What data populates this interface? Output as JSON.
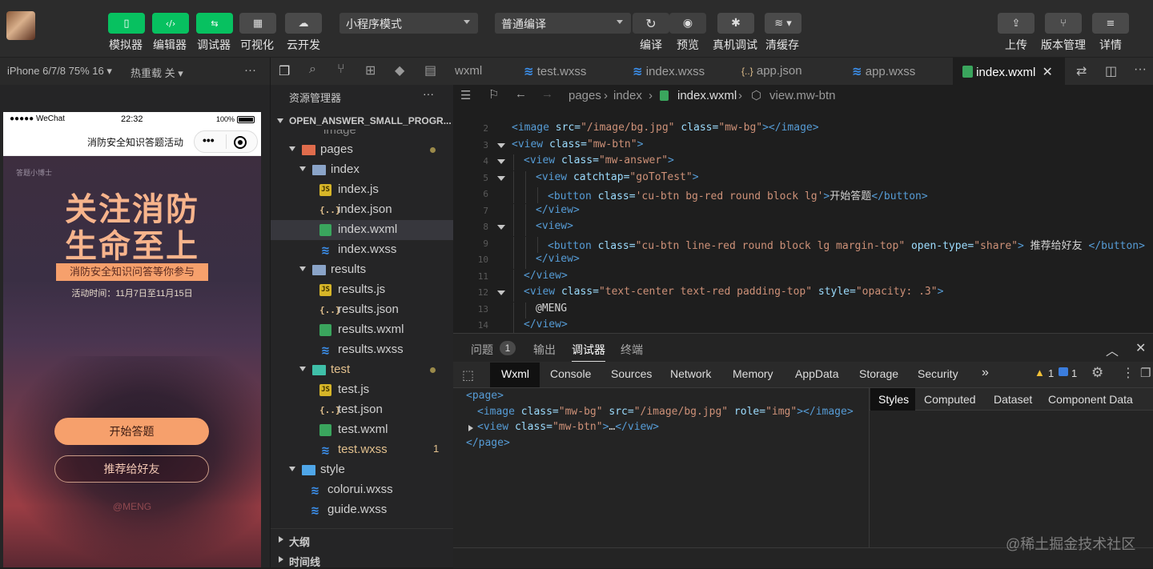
{
  "toolbar": {
    "buttons": [
      {
        "label": "模拟器",
        "icon": "phone-icon"
      },
      {
        "label": "编辑器",
        "icon": "code-icon"
      },
      {
        "label": "调试器",
        "icon": "debug-icon"
      },
      {
        "label": "可视化",
        "icon": "layout-icon"
      },
      {
        "label": "云开发",
        "icon": "cloud-icon"
      }
    ],
    "mode_select": "小程序模式",
    "compile_select": "普通编译",
    "actions": [
      {
        "label": "编译",
        "icon": "refresh-icon"
      },
      {
        "label": "预览",
        "icon": "eye-icon"
      },
      {
        "label": "真机调试",
        "icon": "bug-icon"
      },
      {
        "label": "清缓存",
        "icon": "layers-icon"
      }
    ],
    "right_actions": [
      {
        "label": "上传",
        "icon": "upload-icon"
      },
      {
        "label": "版本管理",
        "icon": "branch-icon"
      },
      {
        "label": "详情",
        "icon": "menu-icon"
      }
    ]
  },
  "simulator": {
    "device": "iPhone 6/7/8 75% 16 ▾",
    "hot_reload": "热重载 关 ▾",
    "more": "···",
    "status_carrier": "●●●●● WeChat",
    "status_time": "22:32",
    "status_battery": "100%",
    "nav_title": "消防安全知识答题活动",
    "brand": "答题小博士",
    "poster_title_1": "关注消防",
    "poster_title_2": "生命至上",
    "poster_banner": "消防安全知识问答等你参与",
    "poster_date": "活动时间：11月7日至11月15日",
    "start_button": "开始答题",
    "share_button": "推荐给好友",
    "footer": "@MENG"
  },
  "explorer": {
    "title": "资源管理器",
    "more": "···",
    "project": "OPEN_ANSWER_SMALL_PROGR...",
    "partial_row": "image",
    "rows": [
      {
        "label": "pages",
        "type": "folder-pages",
        "depth": 1,
        "open": true,
        "dot": true
      },
      {
        "label": "index",
        "type": "folder",
        "depth": 2,
        "open": true
      },
      {
        "label": "index.js",
        "type": "js",
        "depth": 3
      },
      {
        "label": "index.json",
        "type": "json",
        "depth": 3
      },
      {
        "label": "index.wxml",
        "type": "wxml",
        "depth": 3,
        "selected": true
      },
      {
        "label": "index.wxss",
        "type": "wxss",
        "depth": 3
      },
      {
        "label": "results",
        "type": "folder",
        "depth": 2,
        "open": true
      },
      {
        "label": "results.js",
        "type": "js",
        "depth": 3
      },
      {
        "label": "results.json",
        "type": "json",
        "depth": 3
      },
      {
        "label": "results.wxml",
        "type": "wxml",
        "depth": 3
      },
      {
        "label": "results.wxss",
        "type": "wxss",
        "depth": 3
      },
      {
        "label": "test",
        "type": "folder-test",
        "depth": 2,
        "open": true,
        "dot": true,
        "modified": true
      },
      {
        "label": "test.js",
        "type": "js",
        "depth": 3
      },
      {
        "label": "test.json",
        "type": "json",
        "depth": 3
      },
      {
        "label": "test.wxml",
        "type": "wxml",
        "depth": 3
      },
      {
        "label": "test.wxss",
        "type": "wxss",
        "depth": 3,
        "modified": true,
        "count": "1"
      },
      {
        "label": "style",
        "type": "folder-style",
        "depth": 1,
        "open": true
      },
      {
        "label": "colorui.wxss",
        "type": "wxss",
        "depth": 2
      },
      {
        "label": "guide.wxss",
        "type": "wxss",
        "depth": 2
      }
    ],
    "outline": "大纲",
    "timeline": "时间线"
  },
  "editor_tabs": [
    {
      "label": "wxml",
      "icon": ""
    },
    {
      "label": "test.wxss",
      "icon": "wxss"
    },
    {
      "label": "index.wxss",
      "icon": "wxss"
    },
    {
      "label": "app.json",
      "icon": "json"
    },
    {
      "label": "app.wxss",
      "icon": "wxss"
    },
    {
      "label": "index.wxml",
      "icon": "wxml",
      "active": true
    }
  ],
  "breadcrumb": [
    "pages",
    "index",
    "index.wxml",
    "view.mw-btn"
  ],
  "code_lines": [
    {
      "n": "2",
      "indent": 0,
      "fold": false,
      "parts": [
        [
          "tg",
          "<image "
        ],
        [
          "at",
          "src="
        ],
        [
          "st",
          "\"/image/bg.jpg\""
        ],
        [
          "at",
          " class="
        ],
        [
          "st",
          "\"mw-bg\""
        ],
        [
          "tg",
          "></image>"
        ]
      ]
    },
    {
      "n": "3",
      "indent": 0,
      "fold": true,
      "parts": [
        [
          "tg",
          "<view "
        ],
        [
          "at",
          "class="
        ],
        [
          "st",
          "\"mw-btn\""
        ],
        [
          "tg",
          ">"
        ]
      ]
    },
    {
      "n": "4",
      "indent": 1,
      "fold": true,
      "parts": [
        [
          "tg",
          "<view "
        ],
        [
          "at",
          "class="
        ],
        [
          "st",
          "\"mw-answer\""
        ],
        [
          "tg",
          ">"
        ]
      ]
    },
    {
      "n": "5",
      "indent": 2,
      "fold": true,
      "parts": [
        [
          "tg",
          "<view "
        ],
        [
          "at",
          "catchtap="
        ],
        [
          "st",
          "\"goToTest\""
        ],
        [
          "tg",
          ">"
        ]
      ]
    },
    {
      "n": "6",
      "indent": 3,
      "fold": false,
      "parts": [
        [
          "tg",
          "<button "
        ],
        [
          "at",
          "class="
        ],
        [
          "st",
          "'cu-btn bg-red round block lg'"
        ],
        [
          "tg",
          ">"
        ],
        [
          "tx",
          "开始答题"
        ],
        [
          "tg",
          "</button>"
        ]
      ]
    },
    {
      "n": "7",
      "indent": 2,
      "fold": false,
      "parts": [
        [
          "tg",
          "</view>"
        ]
      ]
    },
    {
      "n": "8",
      "indent": 2,
      "fold": true,
      "parts": [
        [
          "tg",
          "<view>"
        ]
      ]
    },
    {
      "n": "9",
      "indent": 3,
      "fold": false,
      "parts": [
        [
          "tg",
          "<button "
        ],
        [
          "at",
          "class="
        ],
        [
          "st",
          "\"cu-btn line-red round block lg margin-top\""
        ],
        [
          "at",
          " open-type="
        ],
        [
          "st",
          "\"share\""
        ],
        [
          "tg",
          ">"
        ],
        [
          "tx",
          " 推荐给好友 "
        ],
        [
          "tg",
          "</button>"
        ]
      ]
    },
    {
      "n": "10",
      "indent": 2,
      "fold": false,
      "parts": [
        [
          "tg",
          "</view>"
        ]
      ]
    },
    {
      "n": "11",
      "indent": 1,
      "fold": false,
      "parts": [
        [
          "tg",
          "</view>"
        ]
      ]
    },
    {
      "n": "12",
      "indent": 1,
      "fold": true,
      "parts": [
        [
          "tg",
          "<view "
        ],
        [
          "at",
          "class="
        ],
        [
          "st",
          "\"text-center text-red padding-top\""
        ],
        [
          "at",
          " style="
        ],
        [
          "st",
          "\"opacity: .3\""
        ],
        [
          "tg",
          ">"
        ]
      ]
    },
    {
      "n": "13",
      "indent": 2,
      "fold": false,
      "parts": [
        [
          "tx",
          "@MENG"
        ]
      ]
    },
    {
      "n": "14",
      "indent": 1,
      "fold": false,
      "parts": [
        [
          "tg",
          "</view>"
        ]
      ]
    }
  ],
  "debugger": {
    "top_tabs": [
      "问题",
      "输出",
      "调试器",
      "终端"
    ],
    "problem_count": "1",
    "panel_tabs": [
      "Wxml",
      "Console",
      "Sources",
      "Network",
      "Memory",
      "AppData",
      "Storage",
      "Security"
    ],
    "more_tabs": "»",
    "warning_count": "1",
    "message_count": "1",
    "dom_lines": [
      {
        "indent": 0,
        "arrow": false,
        "parts": [
          [
            "tg",
            "<page>"
          ]
        ]
      },
      {
        "indent": 1,
        "arrow": false,
        "parts": [
          [
            "tg",
            "<image "
          ],
          [
            "at",
            "class="
          ],
          [
            "st",
            "\"mw-bg\""
          ],
          [
            "at",
            " src="
          ],
          [
            "st",
            "\"/image/bg.jpg\""
          ],
          [
            "at",
            " role="
          ],
          [
            "st",
            "\"img\""
          ],
          [
            "tg",
            "></image>"
          ]
        ]
      },
      {
        "indent": 1,
        "arrow": true,
        "parts": [
          [
            "tg",
            "<view "
          ],
          [
            "at",
            "class="
          ],
          [
            "st",
            "\"mw-btn\""
          ],
          [
            "tg",
            ">"
          ],
          [
            "tx",
            "…"
          ],
          [
            "tg",
            "</view>"
          ]
        ]
      },
      {
        "indent": 0,
        "arrow": false,
        "parts": [
          [
            "tg",
            "</page>"
          ]
        ]
      }
    ],
    "style_tabs": [
      "Styles",
      "Computed",
      "Dataset",
      "Component Data"
    ]
  },
  "watermark": "@稀土掘金技术社区",
  "colors": {
    "accent_green": "#07c160",
    "poster_orange": "#f6a06c"
  }
}
